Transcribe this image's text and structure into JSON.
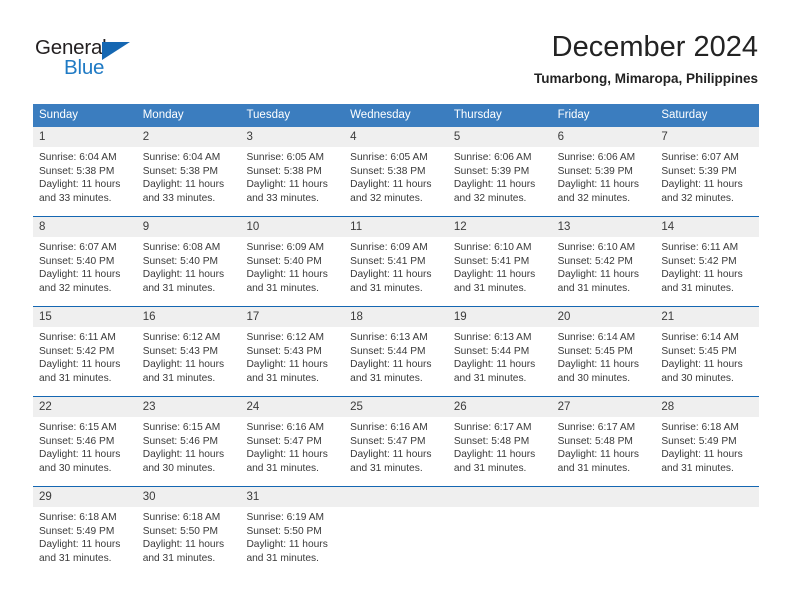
{
  "brand": {
    "name_part1": "General",
    "name_part2": "Blue",
    "accent_color": "#1f7ac4",
    "triangle_color": "#1567b2"
  },
  "header": {
    "month_title": "December 2024",
    "location": "Tumarbong, Mimaropa, Philippines"
  },
  "calendar": {
    "header_bg": "#3b7dbf",
    "row_divider_color": "#1567b2",
    "number_band_bg": "#efefef",
    "weekdays": [
      "Sunday",
      "Monday",
      "Tuesday",
      "Wednesday",
      "Thursday",
      "Friday",
      "Saturday"
    ],
    "weeks": [
      [
        {
          "day": "1",
          "sunrise": "Sunrise: 6:04 AM",
          "sunset": "Sunset: 5:38 PM",
          "daylight": "Daylight: 11 hours and 33 minutes."
        },
        {
          "day": "2",
          "sunrise": "Sunrise: 6:04 AM",
          "sunset": "Sunset: 5:38 PM",
          "daylight": "Daylight: 11 hours and 33 minutes."
        },
        {
          "day": "3",
          "sunrise": "Sunrise: 6:05 AM",
          "sunset": "Sunset: 5:38 PM",
          "daylight": "Daylight: 11 hours and 33 minutes."
        },
        {
          "day": "4",
          "sunrise": "Sunrise: 6:05 AM",
          "sunset": "Sunset: 5:38 PM",
          "daylight": "Daylight: 11 hours and 32 minutes."
        },
        {
          "day": "5",
          "sunrise": "Sunrise: 6:06 AM",
          "sunset": "Sunset: 5:39 PM",
          "daylight": "Daylight: 11 hours and 32 minutes."
        },
        {
          "day": "6",
          "sunrise": "Sunrise: 6:06 AM",
          "sunset": "Sunset: 5:39 PM",
          "daylight": "Daylight: 11 hours and 32 minutes."
        },
        {
          "day": "7",
          "sunrise": "Sunrise: 6:07 AM",
          "sunset": "Sunset: 5:39 PM",
          "daylight": "Daylight: 11 hours and 32 minutes."
        }
      ],
      [
        {
          "day": "8",
          "sunrise": "Sunrise: 6:07 AM",
          "sunset": "Sunset: 5:40 PM",
          "daylight": "Daylight: 11 hours and 32 minutes."
        },
        {
          "day": "9",
          "sunrise": "Sunrise: 6:08 AM",
          "sunset": "Sunset: 5:40 PM",
          "daylight": "Daylight: 11 hours and 31 minutes."
        },
        {
          "day": "10",
          "sunrise": "Sunrise: 6:09 AM",
          "sunset": "Sunset: 5:40 PM",
          "daylight": "Daylight: 11 hours and 31 minutes."
        },
        {
          "day": "11",
          "sunrise": "Sunrise: 6:09 AM",
          "sunset": "Sunset: 5:41 PM",
          "daylight": "Daylight: 11 hours and 31 minutes."
        },
        {
          "day": "12",
          "sunrise": "Sunrise: 6:10 AM",
          "sunset": "Sunset: 5:41 PM",
          "daylight": "Daylight: 11 hours and 31 minutes."
        },
        {
          "day": "13",
          "sunrise": "Sunrise: 6:10 AM",
          "sunset": "Sunset: 5:42 PM",
          "daylight": "Daylight: 11 hours and 31 minutes."
        },
        {
          "day": "14",
          "sunrise": "Sunrise: 6:11 AM",
          "sunset": "Sunset: 5:42 PM",
          "daylight": "Daylight: 11 hours and 31 minutes."
        }
      ],
      [
        {
          "day": "15",
          "sunrise": "Sunrise: 6:11 AM",
          "sunset": "Sunset: 5:42 PM",
          "daylight": "Daylight: 11 hours and 31 minutes."
        },
        {
          "day": "16",
          "sunrise": "Sunrise: 6:12 AM",
          "sunset": "Sunset: 5:43 PM",
          "daylight": "Daylight: 11 hours and 31 minutes."
        },
        {
          "day": "17",
          "sunrise": "Sunrise: 6:12 AM",
          "sunset": "Sunset: 5:43 PM",
          "daylight": "Daylight: 11 hours and 31 minutes."
        },
        {
          "day": "18",
          "sunrise": "Sunrise: 6:13 AM",
          "sunset": "Sunset: 5:44 PM",
          "daylight": "Daylight: 11 hours and 31 minutes."
        },
        {
          "day": "19",
          "sunrise": "Sunrise: 6:13 AM",
          "sunset": "Sunset: 5:44 PM",
          "daylight": "Daylight: 11 hours and 31 minutes."
        },
        {
          "day": "20",
          "sunrise": "Sunrise: 6:14 AM",
          "sunset": "Sunset: 5:45 PM",
          "daylight": "Daylight: 11 hours and 30 minutes."
        },
        {
          "day": "21",
          "sunrise": "Sunrise: 6:14 AM",
          "sunset": "Sunset: 5:45 PM",
          "daylight": "Daylight: 11 hours and 30 minutes."
        }
      ],
      [
        {
          "day": "22",
          "sunrise": "Sunrise: 6:15 AM",
          "sunset": "Sunset: 5:46 PM",
          "daylight": "Daylight: 11 hours and 30 minutes."
        },
        {
          "day": "23",
          "sunrise": "Sunrise: 6:15 AM",
          "sunset": "Sunset: 5:46 PM",
          "daylight": "Daylight: 11 hours and 30 minutes."
        },
        {
          "day": "24",
          "sunrise": "Sunrise: 6:16 AM",
          "sunset": "Sunset: 5:47 PM",
          "daylight": "Daylight: 11 hours and 31 minutes."
        },
        {
          "day": "25",
          "sunrise": "Sunrise: 6:16 AM",
          "sunset": "Sunset: 5:47 PM",
          "daylight": "Daylight: 11 hours and 31 minutes."
        },
        {
          "day": "26",
          "sunrise": "Sunrise: 6:17 AM",
          "sunset": "Sunset: 5:48 PM",
          "daylight": "Daylight: 11 hours and 31 minutes."
        },
        {
          "day": "27",
          "sunrise": "Sunrise: 6:17 AM",
          "sunset": "Sunset: 5:48 PM",
          "daylight": "Daylight: 11 hours and 31 minutes."
        },
        {
          "day": "28",
          "sunrise": "Sunrise: 6:18 AM",
          "sunset": "Sunset: 5:49 PM",
          "daylight": "Daylight: 11 hours and 31 minutes."
        }
      ],
      [
        {
          "day": "29",
          "sunrise": "Sunrise: 6:18 AM",
          "sunset": "Sunset: 5:49 PM",
          "daylight": "Daylight: 11 hours and 31 minutes."
        },
        {
          "day": "30",
          "sunrise": "Sunrise: 6:18 AM",
          "sunset": "Sunset: 5:50 PM",
          "daylight": "Daylight: 11 hours and 31 minutes."
        },
        {
          "day": "31",
          "sunrise": "Sunrise: 6:19 AM",
          "sunset": "Sunset: 5:50 PM",
          "daylight": "Daylight: 11 hours and 31 minutes."
        },
        null,
        null,
        null,
        null
      ]
    ]
  }
}
